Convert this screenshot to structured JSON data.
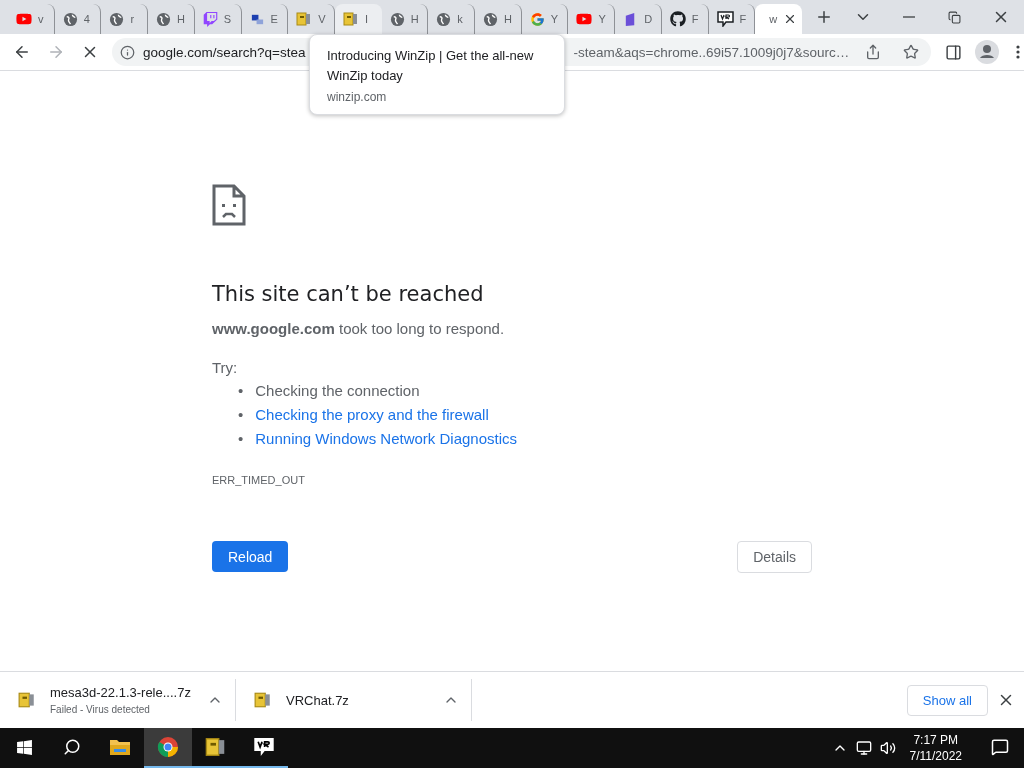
{
  "tabs": [
    {
      "kind": "youtube",
      "title": "v",
      "selected": false,
      "hovered": false
    },
    {
      "kind": "globe",
      "title": "4",
      "selected": false,
      "hovered": false
    },
    {
      "kind": "globe",
      "title": "r",
      "selected": false,
      "hovered": false
    },
    {
      "kind": "globe",
      "title": "H",
      "selected": false,
      "hovered": false
    },
    {
      "kind": "twitch",
      "title": "S",
      "selected": false,
      "hovered": false
    },
    {
      "kind": "app",
      "title": "E",
      "selected": false,
      "hovered": false
    },
    {
      "kind": "winzip",
      "title": "V",
      "selected": false,
      "hovered": false
    },
    {
      "kind": "winzip",
      "title": "I",
      "selected": false,
      "hovered": true
    },
    {
      "kind": "globe",
      "title": "H",
      "selected": false,
      "hovered": false
    },
    {
      "kind": "globe",
      "title": "k",
      "selected": false,
      "hovered": false
    },
    {
      "kind": "globe",
      "title": "H",
      "selected": false,
      "hovered": false
    },
    {
      "kind": "google",
      "title": "Y",
      "selected": false,
      "hovered": false
    },
    {
      "kind": "youtube",
      "title": "Y",
      "selected": false,
      "hovered": false
    },
    {
      "kind": "purple",
      "title": "D",
      "selected": false,
      "hovered": false
    },
    {
      "kind": "github",
      "title": "F",
      "selected": false,
      "hovered": false
    },
    {
      "kind": "vr",
      "title": "F",
      "selected": false,
      "hovered": false
    },
    {
      "kind": "none",
      "title": "w",
      "selected": true,
      "hovered": false
    }
  ],
  "address": {
    "start": "google.com/search?q=stea",
    "end": "-steam&aqs=chrome..69i57.1009j0j7&sourc…",
    "loading": true
  },
  "tooltip": {
    "title": "Introducing WinZip | Get the all-new WinZip today",
    "domain": "winzip.com"
  },
  "error": {
    "heading": "This site can’t be reached",
    "message": "**www.google.com** took too long to respond.",
    "try_label": "Try:",
    "suggestions": [
      {
        "marker": "•",
        "text": "Checking the connection",
        "kind": "plain"
      },
      {
        "marker": "•",
        "text": "Checking the proxy and the firewall",
        "kind": "link"
      },
      {
        "marker": "•",
        "text": "Running Windows Network Diagnostics",
        "kind": "link"
      }
    ],
    "code": "ERR_TIMED_OUT",
    "reload": "Reload",
    "details": "Details"
  },
  "downloads": [
    {
      "name": "mesa3d-22.1.3-rele....7z",
      "status": "Failed - Virus detected"
    },
    {
      "name": "VRChat.7z"
    }
  ],
  "show_all": "Show all",
  "taskbar": {
    "apps": [
      {
        "kind": "explorer",
        "running": false,
        "selected": false
      },
      {
        "kind": "chrome",
        "running": true,
        "selected": true
      },
      {
        "kind": "winzip",
        "running": true,
        "selected": false
      },
      {
        "kind": "vr",
        "running": true,
        "selected": false
      }
    ],
    "time": "7:17 PM",
    "date": "7/11/2022"
  }
}
